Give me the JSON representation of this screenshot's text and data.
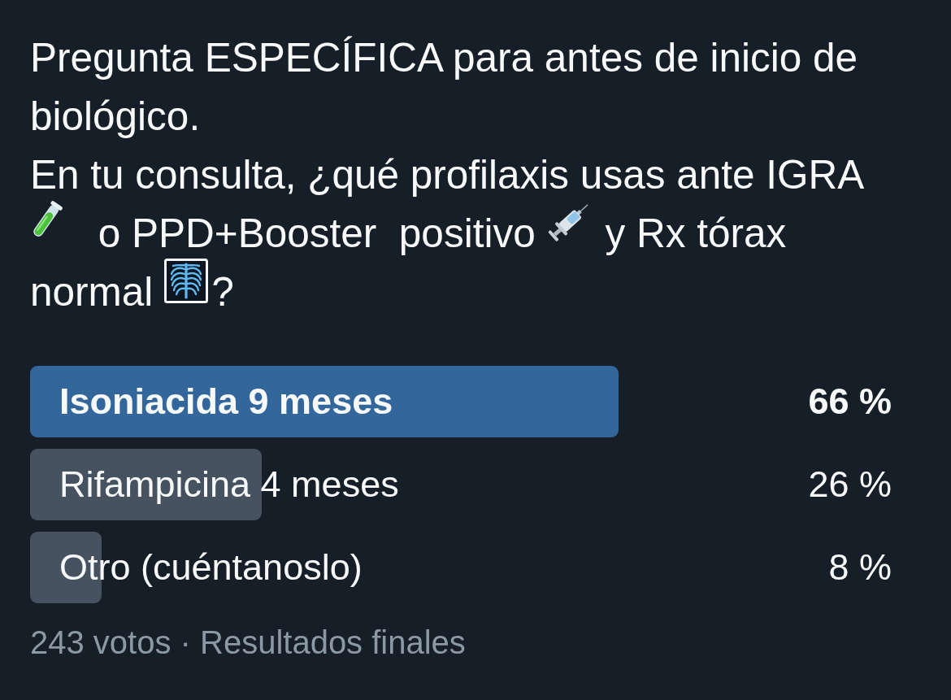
{
  "question": {
    "paragraphs": [
      [
        {
          "kind": "text",
          "text": "Pregunta ESPECÍFICA para antes de inicio de biológico."
        }
      ],
      [
        {
          "kind": "text",
          "text": "En tu consulta, ¿qué profilaxis usas ante IGRA"
        },
        {
          "kind": "tube"
        },
        {
          "kind": "text",
          "text": " o PPD+Booster  positivo"
        },
        {
          "kind": "syringe"
        },
        {
          "kind": "text",
          "text": " y Rx tórax"
        },
        {
          "kind": "text",
          "text": "normal"
        },
        {
          "kind": "xray"
        },
        {
          "kind": "text",
          "text": "?"
        }
      ]
    ]
  },
  "poll": {
    "options": [
      {
        "label": "Isoniacida 9 meses",
        "percent": "66 %",
        "level": 0.66,
        "winner": true
      },
      {
        "label": "Rifampicina 4 meses",
        "percent": "26 %",
        "level": 0.26,
        "winner": false
      },
      {
        "label": "Otro (cuéntanoslo)",
        "percent": "8 %",
        "level": 0.08,
        "winner": false
      }
    ],
    "footer": "243 votos · Resultados finales"
  }
}
